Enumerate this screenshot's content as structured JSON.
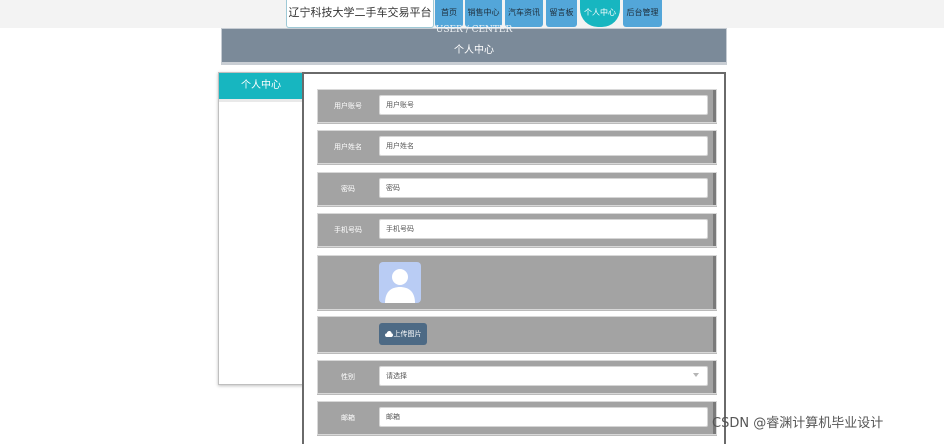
{
  "header": {
    "site_title": "辽宁科技大学二手车交易平台",
    "nav": [
      "首页",
      "销售中心",
      "汽车资讯",
      "留言板",
      "个人中心",
      "后台管理"
    ],
    "active_nav": "个人中心"
  },
  "banner": {
    "title_en": "USER / CENTER",
    "title_cn": "个人中心"
  },
  "sidebar": {
    "heading": "个人中心"
  },
  "form": {
    "username": {
      "label": "用户账号",
      "placeholder": "用户账号"
    },
    "name": {
      "label": "用户姓名",
      "placeholder": "用户姓名"
    },
    "password": {
      "label": "密码",
      "placeholder": "密码"
    },
    "phone": {
      "label": "手机号码",
      "placeholder": "手机号码"
    },
    "upload_label": "上传图片",
    "gender": {
      "label": "性别",
      "selected": "请选择"
    },
    "email": {
      "label": "邮箱",
      "placeholder": "邮箱"
    }
  },
  "watermark": "CSDN @睿渊计算机毕业设计",
  "colors": {
    "accent": "#17b6c0",
    "nav": "#53a6d9",
    "banner": "#7b8a99",
    "row_bg": "#a3a3a3",
    "upload_btn": "#4d6a85"
  }
}
